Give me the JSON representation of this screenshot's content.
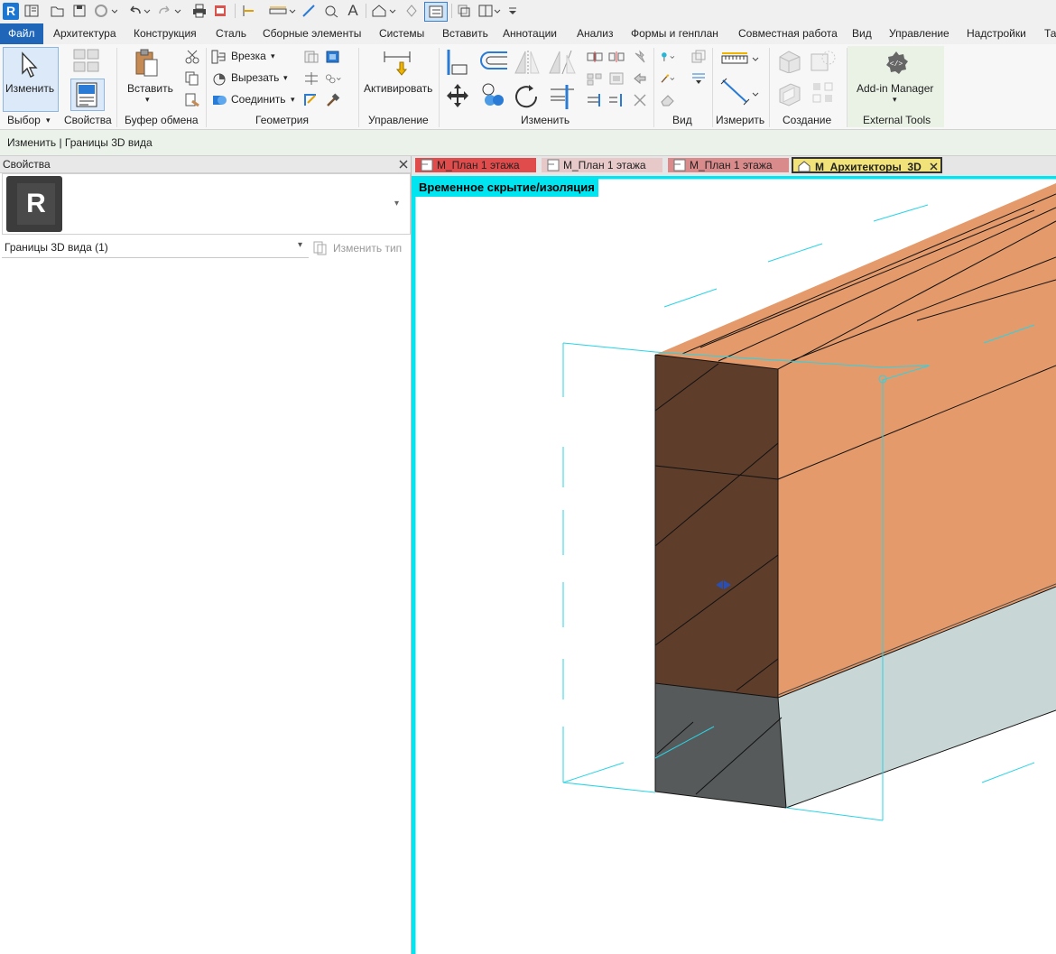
{
  "app": {
    "logo_letter": "R"
  },
  "ribbon_tabs": [
    "Файл",
    "Архитектура",
    "Конструкция",
    "Сталь",
    "Сборные элементы",
    "Системы",
    "Вставить",
    "Аннотации",
    "Анализ",
    "Формы и генплан",
    "Совместная работа",
    "Вид",
    "Управление",
    "Надстройки",
    "Та"
  ],
  "ribbon": {
    "modify_label": "Изменить",
    "properties_label": "Свойства",
    "paste_label": "Вставить",
    "cope_label": "Врезка",
    "cut_label": "Вырезать",
    "join_label": "Соединить",
    "activate_label": "Активировать",
    "addin_label": "Add-in Manager",
    "panels": {
      "select": "Выбор",
      "properties": "Свойства",
      "clipboard": "Буфер обмена",
      "geometry": "Геометрия",
      "control": "Управление",
      "modify": "Изменить",
      "view": "Вид",
      "measure": "Измерить",
      "create": "Создание",
      "external": "External Tools"
    }
  },
  "context_bar": {
    "text": "Изменить | Границы 3D вида"
  },
  "properties": {
    "title": "Свойства",
    "type_letter": "R",
    "instance_filter": "Границы 3D вида (1)",
    "edit_type_label": "Изменить тип"
  },
  "doc_tabs": [
    {
      "label": "М_План 1 этажа",
      "color": "#e04b4b"
    },
    {
      "label": "М_План 1 этажа",
      "color": "#e8c9c9"
    },
    {
      "label": "М_План 1 этажа",
      "color": "#d98a8a"
    },
    {
      "label": "М_Архитекторы_3D",
      "color": "#f2e27a",
      "active": true
    }
  ],
  "view": {
    "banner": "Временное скрытие/изоляция",
    "banner_color": "#00e5f0",
    "colors": {
      "brick": "#e49a6b",
      "brick_cut": "#5e3d2b",
      "concrete": "#c8d6d6",
      "concrete_cut": "#575a5a",
      "section_box": "#29d4e6"
    }
  },
  "icons": [
    "cursor-icon",
    "properties-icon",
    "paste-icon",
    "scissors-icon",
    "cope-icon",
    "cut-geometry-icon",
    "join-icon",
    "activate-icon",
    "move-icon",
    "rotate-icon",
    "align-icon",
    "offset-icon",
    "mirror-icon",
    "measure-icon",
    "dimension-icon",
    "addin-gear-icon",
    "close-icon",
    "dropdown-icon",
    "home-3d-icon"
  ]
}
